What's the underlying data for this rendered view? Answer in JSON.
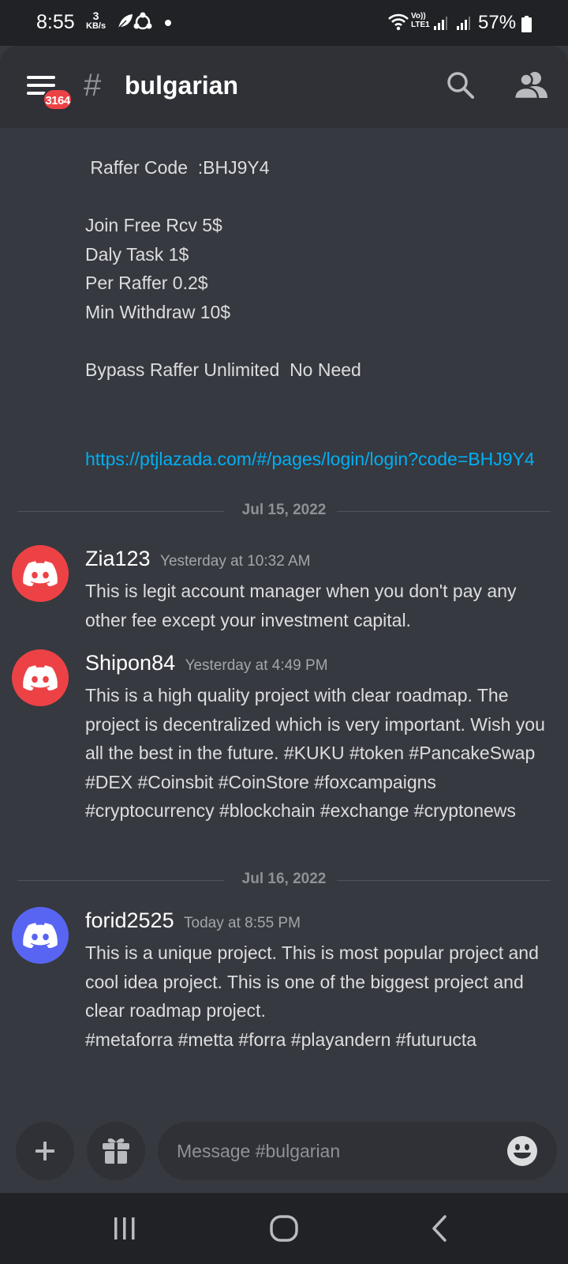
{
  "status_bar": {
    "time": "8:55",
    "net_speed_value": "3",
    "net_speed_unit": "KB/s",
    "volte_label": "Vo))",
    "lte_label": "LTE1",
    "battery_percent": "57%"
  },
  "header": {
    "notification_count": "3164",
    "hash": "#",
    "channel_name": "bulgarian"
  },
  "first_message": {
    "lines": [
      " Raffer Code  :BHJ9Y4",
      "",
      "Join Free Rcv 5$",
      "Daly Task 1$",
      "Per Raffer 0.2$",
      "Min Withdraw 10$",
      "",
      "Bypass Raffer Unlimited  No Need",
      "",
      ""
    ],
    "link": "https://ptjlazada.com/#/pages/login/login?code=BHJ9Y4"
  },
  "dividers": {
    "d1": "Jul 15, 2022",
    "d2": "Jul 16, 2022"
  },
  "messages": [
    {
      "username": "Zia123",
      "timestamp": "Yesterday at 10:32 AM",
      "avatar_color": "#ed4245",
      "text": "This is legit account manager when you don't pay any other fee except your investment capital."
    },
    {
      "username": "Shipon84",
      "timestamp": "Yesterday at 4:49 PM",
      "avatar_color": "#ed4245",
      "text": "This is a high quality project with clear roadmap. The project is decentralized which is very important. Wish you all the best in the future. #KUKU #token #PancakeSwap #DEX #Coinsbit #CoinStore #foxcampaigns #cryptocurrency #blockchain #exchange #cryptonews"
    },
    {
      "username": "forid2525",
      "timestamp": "Today at 8:55 PM",
      "avatar_color": "#5865f2",
      "text": "This is a unique project. This is most popular project and cool idea project. This is one of the biggest project and clear roadmap project.\n #metaforra #metta #forra #playandern #futuructa"
    }
  ],
  "composer": {
    "placeholder": "Message #bulgarian"
  },
  "icons": {
    "menu": "hamburger-menu-icon",
    "search": "search-icon",
    "members": "members-icon",
    "add": "plus-icon",
    "gift": "gift-icon",
    "emoji": "emoji-icon",
    "recents": "recent-apps-icon",
    "home": "home-icon",
    "back": "back-icon"
  },
  "colors": {
    "background": "#36393f",
    "header": "#2f3136",
    "link": "#00aff4",
    "badge": "#ed4245",
    "blurple": "#5865f2"
  }
}
